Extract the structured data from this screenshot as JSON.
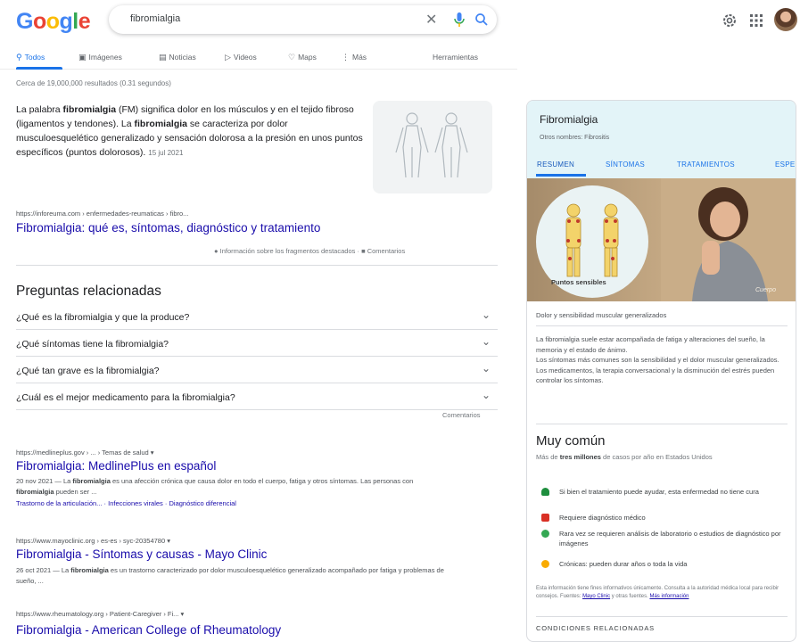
{
  "header": {
    "logo": [
      "G",
      "o",
      "o",
      "g",
      "l",
      "e"
    ],
    "logo_colors": [
      "#4285f4",
      "#ea4335",
      "#fbbc05",
      "#4285f4",
      "#34a853",
      "#ea4335"
    ],
    "query": "fibromialgia"
  },
  "tabs": {
    "items": [
      {
        "label": "Todos",
        "icon": "search-icon"
      },
      {
        "label": "Imágenes",
        "icon": "image-icon"
      },
      {
        "label": "Noticias",
        "icon": "news-icon"
      },
      {
        "label": "Videos",
        "icon": "video-icon"
      },
      {
        "label": "Maps",
        "icon": "map-pin-icon"
      },
      {
        "label": "Más",
        "icon": "more-vert-icon"
      }
    ],
    "tools": "Herramientas"
  },
  "result_stats": "Cerca de 19,000,000 resultados (0.31 segundos)",
  "snippet": {
    "t1": "La palabra ",
    "b1": "fibromialgia",
    "t2": " (FM) significa dolor en los músculos y en el tejido fibroso (ligamentos y tendones). La ",
    "b2": "fibromialgia",
    "t3": " se caracteriza por dolor musculoesquelético generalizado y sensación dolorosa a la presión en unos puntos específicos (puntos dolorosos).",
    "date": "15 jul 2021",
    "source": "https://inforeuma.com › enfermedades-reumaticas › fibro...",
    "link": "Fibromialgia: qué es, síntomas, diagnóstico y tratamiento",
    "about": "Información sobre los fragmentos destacados",
    "comments": "Comentarios"
  },
  "paa": {
    "title": "Preguntas relacionadas",
    "questions": [
      "¿Qué es la fibromialgia y que la produce?",
      "¿Qué síntomas tiene la fibromialgia?",
      "¿Qué tan grave es la fibromialgia?",
      "¿Cuál es el mejor medicamento para la fibromialgia?"
    ],
    "feedback": "Comentarios"
  },
  "results": [
    {
      "url": "https://medlineplus.gov › ... › Temas de salud ▾",
      "title": "Fibromialgia: MedlinePlus en español",
      "snip_a": "20 nov 2021 — La ",
      "snip_b": "fibromialgia",
      "snip_c": " es una afección crónica que causa dolor en todo el cuerpo, fatiga y otros síntomas. Las personas con ",
      "snip_d": "fibromialgia",
      "snip_e": " pueden ser ...",
      "sitelinks": [
        "Trastorno de la articulación...",
        "Infecciones virales",
        "Diagnóstico diferencial"
      ]
    },
    {
      "url": "https://www.mayoclinic.org › es-es › syc-20354780 ▾",
      "title": "Fibromialgia - Síntomas y causas - Mayo Clinic",
      "snip_a": "26 oct 2021 — La ",
      "snip_b": "fibromialgia",
      "snip_c": " es un trastorno caracterizado por dolor musculoesquelético generalizado acompañado por fatiga y problemas de sueño, ..."
    },
    {
      "url": "https://www.rheumatology.org › Patient-Caregiver › Fi... ▾",
      "title": "Fibromialgia - American College of Rheumatology"
    }
  ],
  "kp": {
    "title": "Fibromialgia",
    "subtitle": "Otros nombres: Fibrositis",
    "tabs": [
      "RESUMEN",
      "SÍNTOMAS",
      "TRATAMIENTOS",
      "ESPE"
    ],
    "image_label": "Puntos sensibles",
    "image_credit": "Cuerpo",
    "lead": "Dolor y sensibilidad muscular generalizados",
    "desc1": "La fibromialgia suele estar acompañada de fatiga y alteraciones del sueño, la memoria y el estado de ánimo.",
    "desc2": "Los síntomas más comunes son la sensibilidad y el dolor muscular generalizados.",
    "desc3": "Los medicamentos, la terapia conversacional y la disminución del estrés pueden controlar los síntomas.",
    "common_title": "Muy común",
    "common_pre": "Más de ",
    "common_b": "tres millones",
    "common_post": " de casos por año en Estados Unidos",
    "facts": [
      {
        "text": "Si bien el tratamiento puede ayudar, esta enfermedad no tiene cura",
        "color": "#1e8e3e",
        "icon": "person-icon"
      },
      {
        "text": "Requiere diagnóstico médico",
        "color": "#d93025",
        "icon": "calendar-icon"
      },
      {
        "text": "Rara vez se requieren análisis de laboratorio o estudios de diagnóstico por imágenes",
        "color": "#34a853",
        "icon": "lab-icon"
      },
      {
        "text": "Crónicas: pueden durar años o toda la vida",
        "color": "#f9ab00",
        "icon": "clock-icon"
      }
    ],
    "disclaimer": "Esta información tiene fines informativos únicamente. Consulta a la autoridad médica local para recibir consejos.",
    "sources_label": "Fuentes:",
    "source_mayo": "Mayo Clinic",
    "sources_others": "y otras fuentes.",
    "more_info": "Más información",
    "related": "CONDICIONES RELACIONADAS"
  }
}
